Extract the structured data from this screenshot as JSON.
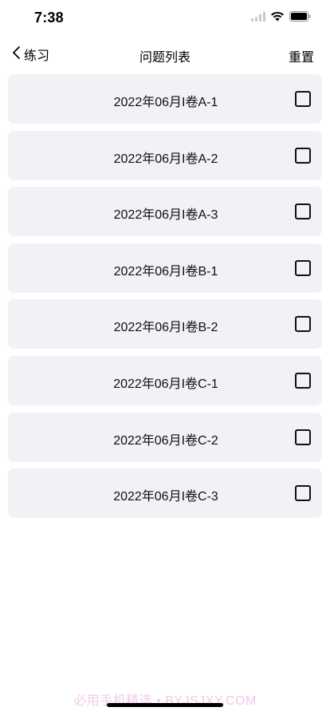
{
  "status_bar": {
    "time": "7:38",
    "icons": [
      "signal-icon",
      "wifi-icon",
      "battery-icon"
    ]
  },
  "nav": {
    "back_label": "练习",
    "title": "问题列表",
    "reset_label": "重置"
  },
  "questions": [
    {
      "label": "2022年06月I卷A-1",
      "checked": false
    },
    {
      "label": "2022年06月I卷A-2",
      "checked": false
    },
    {
      "label": "2022年06月I卷A-3",
      "checked": false
    },
    {
      "label": "2022年06月I卷B-1",
      "checked": false
    },
    {
      "label": "2022年06月I卷B-2",
      "checked": false
    },
    {
      "label": "2022年06月I卷C-1",
      "checked": false
    },
    {
      "label": "2022年06月I卷C-2",
      "checked": false
    },
    {
      "label": "2022年06月I卷C-3",
      "checked": false
    }
  ],
  "watermark": "必用手机精选 • BYJSJXY.COM",
  "colors": {
    "item_background": "#f1f1f6",
    "watermark": "#f3c9e6",
    "text": "#000000"
  }
}
